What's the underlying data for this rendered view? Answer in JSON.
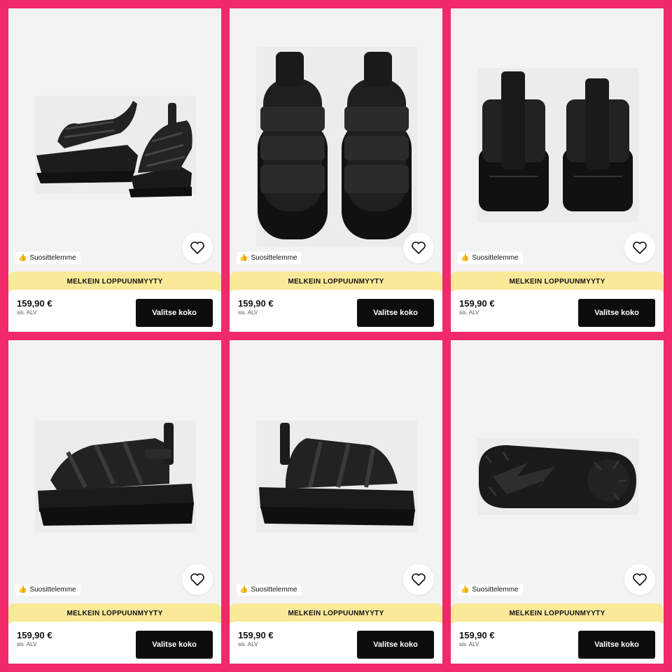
{
  "colors": {
    "background": "#f0296a",
    "banner": "#fbe99a",
    "button": "#0d0d0d",
    "card": "#f3f3f3"
  },
  "products": [
    {
      "view": "pair-side",
      "badge": "Suosittelemme",
      "badge_icon": "thumbs-up-icon",
      "banner": "MELKEIN LOPPUUNMYYTY",
      "price": "159,90 €",
      "vat": "sis. ALV",
      "button": "Valitse koko"
    },
    {
      "view": "pair-top",
      "badge": "Suosittelemme",
      "badge_icon": "thumbs-up-icon",
      "banner": "MELKEIN LOPPUUNMYYTY",
      "price": "159,90 €",
      "vat": "sis. ALV",
      "button": "Valitse koko"
    },
    {
      "view": "pair-back",
      "badge": "Suosittelemme",
      "badge_icon": "thumbs-up-icon",
      "banner": "MELKEIN LOPPUUNMYYTY",
      "price": "159,90 €",
      "vat": "sis. ALV",
      "button": "Valitse koko"
    },
    {
      "view": "single-outer",
      "badge": "Suosittelemme",
      "badge_icon": "thumbs-up-icon",
      "banner": "MELKEIN LOPPUUNMYYTY",
      "price": "159,90 €",
      "vat": "sis. ALV",
      "button": "Valitse koko"
    },
    {
      "view": "single-inner",
      "badge": "Suosittelemme",
      "badge_icon": "thumbs-up-icon",
      "banner": "MELKEIN LOPPUUNMYYTY",
      "price": "159,90 €",
      "vat": "sis. ALV",
      "button": "Valitse koko"
    },
    {
      "view": "sole",
      "badge": "Suosittelemme",
      "badge_icon": "thumbs-up-icon",
      "banner": "MELKEIN LOPPUUNMYYTY",
      "price": "159,90 €",
      "vat": "sis. ALV",
      "button": "Valitse koko"
    }
  ]
}
